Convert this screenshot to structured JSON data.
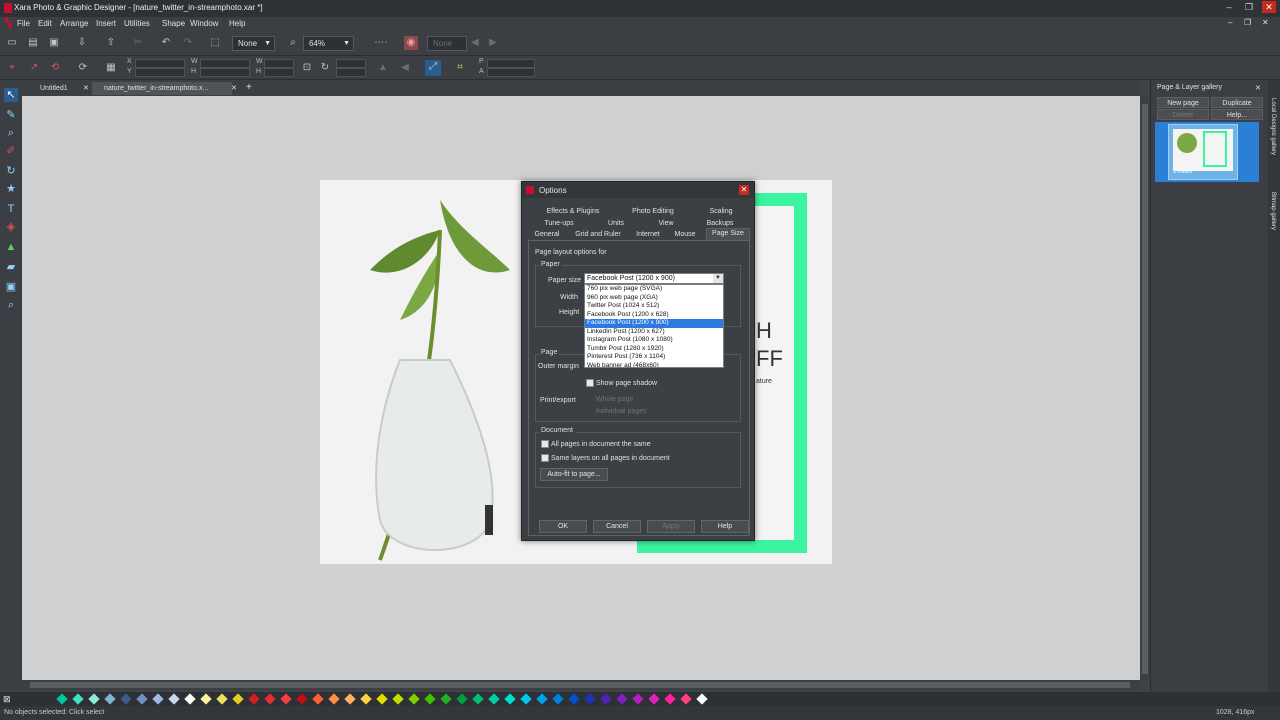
{
  "window": {
    "title": "Xara Photo & Graphic Designer - [nature_twitter_in-streamphoto.xar *]",
    "minimize": "–",
    "restore": "❐",
    "close": "✕"
  },
  "menu": [
    "File",
    "Edit",
    "Arrange",
    "Insert",
    "Utilities",
    "Shape",
    "Window",
    "Help"
  ],
  "toolbar": {
    "quality_value": "None",
    "zoom_value": "64%",
    "feather_value": "None",
    "coord_labels": [
      "X",
      "Y",
      "W",
      "H",
      "W",
      "H",
      "P",
      "A"
    ]
  },
  "doc_tabs": [
    {
      "label": "Untitled1",
      "active": false
    },
    {
      "label": "nature_twitter_in-streamphoto.x...",
      "active": true
    }
  ],
  "page_art": {
    "letters_top": "H",
    "letters_bottom": "FF",
    "small_text": "ature"
  },
  "gallery": {
    "title": "Page & Layer gallery",
    "buttons": {
      "new_page": "New page",
      "duplicate": "Duplicate",
      "delete": "Delete",
      "help": "Help..."
    },
    "page_label": "1.index",
    "side_tabs": [
      "Local Designs gallery",
      "Bitmap gallery"
    ]
  },
  "dialog": {
    "title": "Options",
    "tabs_row1": [
      "Effects & Plugins",
      "Photo Editing",
      "Scaling"
    ],
    "tabs_row2": [
      "Tune-ups",
      "Units",
      "View",
      "Backups"
    ],
    "tabs_row3": [
      "General",
      "Grid and Ruler",
      "Internet",
      "Mouse",
      "Page Size"
    ],
    "heading": "Page layout options for",
    "paper_group": "Paper",
    "paper_size_label": "Paper size",
    "paper_size_value": "Facebook Post (1200 x 900)",
    "width_label": "Width",
    "height_label": "Height",
    "page_group": "Page",
    "outer_margin_label": "Outer margin",
    "show_shadow_label": "Show page shadow",
    "print_export_label": "Print/export",
    "whole_page_label": "Whole page",
    "individual_pages_label": "Individual pages",
    "document_group": "Document",
    "all_pages_same_label": "All pages in document the same",
    "same_layers_label": "Same layers on all pages in document",
    "autofit_button": "Auto-fit to page...",
    "ok_button": "OK",
    "cancel_button": "Cancel",
    "apply_button": "Apply",
    "help_button": "Help",
    "dropdown_options": [
      "760 pix web page (SVGA)",
      "960 pix web page (XGA)",
      "Twitter Post (1024 x 512)",
      "Facebook Post (1200 x 628)",
      "Facebook Post (1200 x 900)",
      "LinkedIn Post (1200 x 627)",
      "Instagram Post (1080 x 1080)",
      "Tumblr Post (1280 x 1920)",
      "Pinterest Post (736 x 1104)",
      "Web banner ad (468x60)"
    ],
    "dropdown_selected_index": 4
  },
  "status": {
    "left": "No objects selected: Click select",
    "right": "1028, 416px"
  },
  "palette_colors": [
    "#00c8a0",
    "#3de0c0",
    "#8fe8d8",
    "#7fb3d5",
    "#3c5a8a",
    "#7090c0",
    "#a0b8e0",
    "#c8d8f0",
    "#ffffff",
    "#fff3a0",
    "#f0e060",
    "#e0d020",
    "#d02020",
    "#e03030",
    "#f04040",
    "#c01010",
    "#ff6030",
    "#ff9040",
    "#ffb060",
    "#ffd040",
    "#e0e000",
    "#c0e000",
    "#80d000",
    "#40c000",
    "#20b020",
    "#00a040",
    "#00c070",
    "#00d0a0",
    "#00e0d0",
    "#00c8f0",
    "#00a0f0",
    "#0080e0",
    "#0050d0",
    "#2030c0",
    "#5020c0",
    "#8020c0",
    "#b020c0",
    "#e020c0",
    "#ff20a0",
    "#ff4080",
    "#ffffff"
  ]
}
